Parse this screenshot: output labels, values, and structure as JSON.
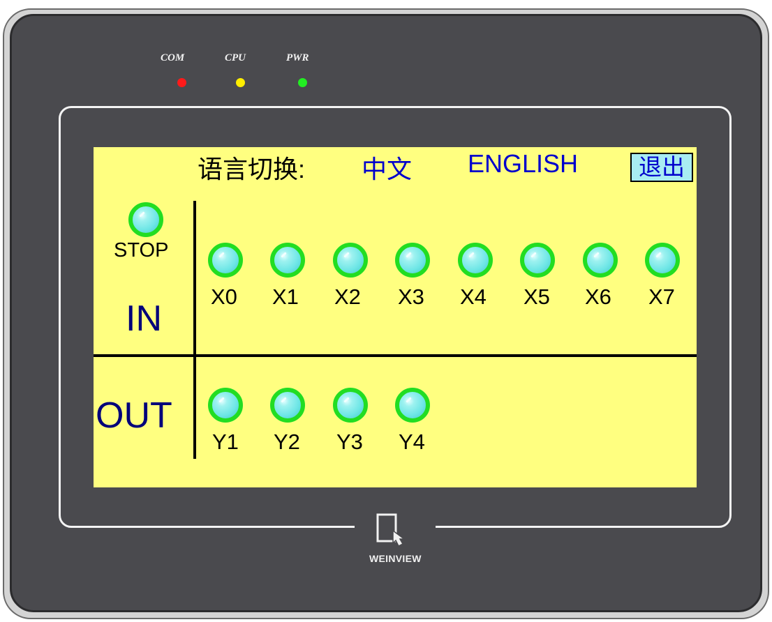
{
  "indicators": [
    {
      "label": "COM",
      "color": "#ff1a1a"
    },
    {
      "label": "CPU",
      "color": "#ffee00"
    },
    {
      "label": "PWR",
      "color": "#22ee22"
    }
  ],
  "language": {
    "label": "语言切换:",
    "chinese": "中文",
    "english": "ENGLISH",
    "exit": "退出"
  },
  "stop": {
    "label": "STOP"
  },
  "inputs": {
    "title": "IN",
    "items": [
      "X0",
      "X1",
      "X2",
      "X3",
      "X4",
      "X5",
      "X6",
      "X7"
    ]
  },
  "outputs": {
    "title": "OUT",
    "items": [
      "Y1",
      "Y2",
      "Y3",
      "Y4"
    ]
  },
  "brand": "WEINVIEW",
  "colors": {
    "lcd_background": "#ffff80",
    "lamp_ring": "#22dd22",
    "lamp_fill": "#6ee6e6",
    "bezel": "#4a4a4e",
    "label_blue": "#0000cc"
  },
  "icons": {
    "brand_logo": "touch-hand-icon"
  }
}
